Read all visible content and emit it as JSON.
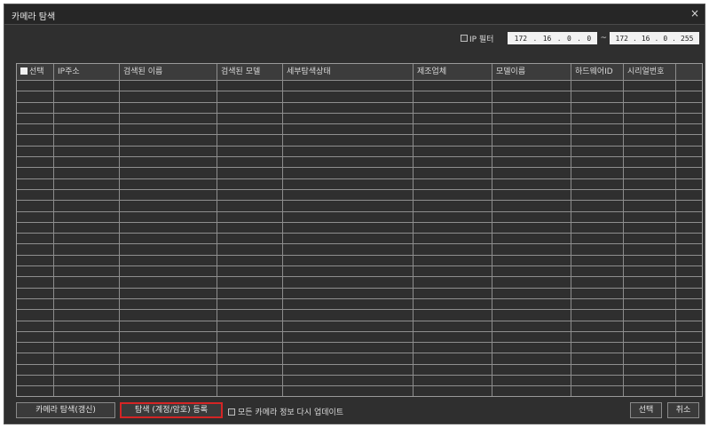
{
  "window": {
    "title": "카메라 탐색",
    "close_glyph": "×"
  },
  "ip_filter": {
    "label": "IP 필터",
    "range_sep": "~",
    "start": [
      "172",
      "16",
      "0",
      "0"
    ],
    "end": [
      "172",
      "16",
      "0",
      "255"
    ]
  },
  "table": {
    "select_label": "선택",
    "columns": [
      "IP주소",
      "검색된 이름",
      "검색된 모델",
      "세부탐색상태",
      "제조업체",
      "모델이름",
      "하드웨어ID",
      "시리얼번호"
    ]
  },
  "footer": {
    "refresh_button": "카메라 탐색(갱신)",
    "register_button": "탐색 (계정/암호) 등록",
    "update_all_label": "모든 카메라 정보 다시 업데이트",
    "select_button": "선택",
    "cancel_button": "취소"
  },
  "colors": {
    "dialog_bg": "#2f2f2f",
    "highlight": "#d42525"
  }
}
